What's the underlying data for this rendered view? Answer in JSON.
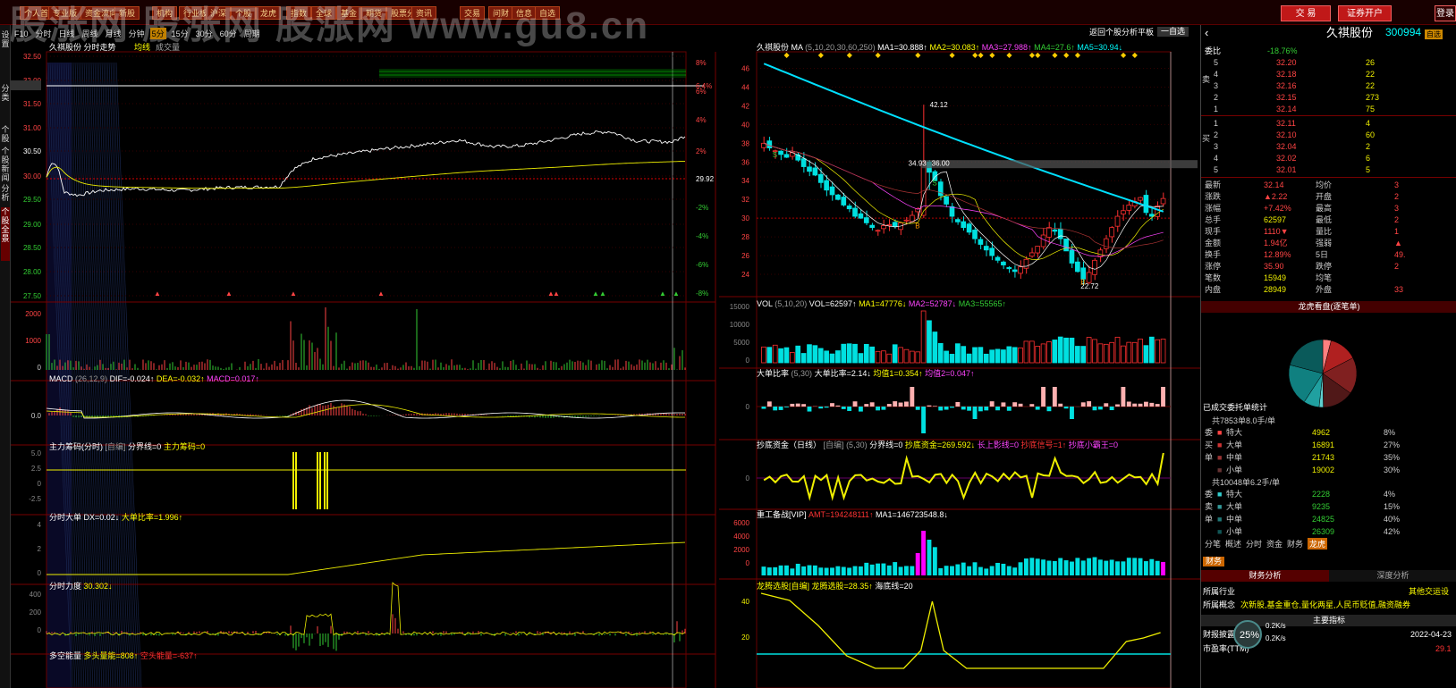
{
  "toolbar": {
    "buttons": [
      "个人首页",
      "专业版",
      "资金流向",
      "新股",
      "机构",
      "行业板块",
      "沪深",
      "个股",
      "龙虎",
      "指数",
      "全球",
      "基金",
      "期货",
      "股票分析",
      "资讯",
      "交易",
      "问财",
      "信息",
      "自选"
    ],
    "trade": "交 易",
    "open_account": "证券开户",
    "login": "登录"
  },
  "watermark": "股涨网 股涨网 股涨网 www.gu8.cn",
  "left_strip": [
    "设置",
    "分类",
    "个股",
    "个股新闻",
    "分析",
    "个股全景"
  ],
  "timeline_tabs": [
    "F10",
    "分时",
    "日线",
    "周线",
    "月线",
    "分钟",
    "5分",
    "15分",
    "30分",
    "60分",
    "周期"
  ],
  "intraday": {
    "title": "久祺股份 分时走势",
    "legend1": "均线",
    "legend2": "成交量",
    "price_left": [
      "32.50",
      "32.00",
      "31.85",
      "31.50",
      "31.00",
      "30.50",
      "30.00",
      "29.50",
      "29.00",
      "28.50",
      "28.00",
      "27.50"
    ],
    "pct_right": [
      "8%",
      "6.4%",
      "6%",
      "4%",
      "2%",
      "29.92",
      "-2%",
      "-4%",
      "-6%",
      "-8%"
    ],
    "vol_ticks": [
      "2000",
      "1000",
      "0"
    ],
    "macd_label": "MACD",
    "macd_params": "(26,12,9)",
    "dif": "DIF=-0.024↑",
    "dea": "DEA=-0.032↑",
    "macd": "MACD=0.017↑",
    "macd_tick": "0.0",
    "zl_label": "主力筹码(分时)",
    "zl_meta": "[自编]",
    "zl_val": "分界线=0",
    "zl_val2": "主力筹码=0",
    "dd_label": "分时大单",
    "dd_val": "DX=0.02↓",
    "dd_val2": "大单比率=1.996↑",
    "ld_label": "分时力度",
    "ld_val": "30.302↓",
    "ld_ticks": [
      "400",
      "200",
      "0"
    ],
    "dk_label": "多空能量",
    "dk_val": "多头量能=808↑",
    "dk_val2": "空头能量=-637↑"
  },
  "kline": {
    "title": "久祺股份",
    "ma_label": "MA",
    "ma_params": "(5,10,20,30,60,250)",
    "ma1": "MA1=30.888↑",
    "ma2": "MA2=30.083↑",
    "ma3": "MA3=27.988↑",
    "ma4": "MA4=27.6↑",
    "ma5": "MA5=30.94↓",
    "header_right": "返回个股分析",
    "header_r2": "平板",
    "header_r3": "一自选",
    "price_ticks": [
      "46",
      "44",
      "42",
      "40",
      "38",
      "36",
      "34",
      "32",
      "30",
      "28",
      "26",
      "24"
    ],
    "hi_label": "42.12",
    "mid_label1": "34.93",
    "mid_label2": "36.00",
    "lo_label": "22.72",
    "vol_label": "VOL",
    "vol_params": "(5,10,20)",
    "vol": "VOL=62597↑",
    "vma1": "MA1=47776↓",
    "vma2": "MA2=52787↓",
    "vma3": "MA3=55565↑",
    "vol_ticks": [
      "15000",
      "10000",
      "5000",
      "0"
    ],
    "dd_label": "大单比率",
    "dd_params": "(5,30)",
    "dd_val": "大单比率=2.14↓",
    "dd_v1": "均值1=0.354↑",
    "dd_v2": "均值2=0.047↑",
    "dd_tick": "0",
    "cd_label": "抄底资金（日线）",
    "cd_meta": "[自编]",
    "cd_params": "(5,30)",
    "cd_v": "分界线=0",
    "cd_v1": "抄底资金=269.592↓",
    "cd_v2": "长上影线=0",
    "cd_v3": "抄底信号=1↑",
    "cd_v4": "抄底小霸王=0",
    "cd_tick": "0",
    "zj_label": "重工备战[VIP]",
    "zj_v1": "AMT=194248111↑",
    "zj_v2": "MA1=146723548.8↓",
    "zj_ticks": [
      "6000",
      "4000",
      "2000",
      "0"
    ],
    "ld_label": "龙腾选股[自编]",
    "ld_v1": "龙腾选股=28.35↑",
    "ld_v2": "海底线=20",
    "ld_ticks": [
      "40",
      "20"
    ]
  },
  "quote": {
    "name": "久祺股份",
    "code": "300994",
    "tag": "自选",
    "webi_label": "委比",
    "webi_val": "-18.76%",
    "sells": [
      [
        "5",
        "32.20",
        "26"
      ],
      [
        "4",
        "32.18",
        "22"
      ],
      [
        "3",
        "32.16",
        "22"
      ],
      [
        "2",
        "32.15",
        "273"
      ],
      [
        "1",
        "32.14",
        "75"
      ]
    ],
    "buys": [
      [
        "1",
        "32.11",
        "4"
      ],
      [
        "2",
        "32.10",
        "60"
      ],
      [
        "3",
        "32.04",
        "2"
      ],
      [
        "4",
        "32.02",
        "6"
      ],
      [
        "5",
        "32.01",
        "5"
      ]
    ],
    "sell_side": "卖",
    "buy_side": "买",
    "pan": "盘",
    "stats": [
      [
        "最新",
        "32.14",
        "均价",
        "3"
      ],
      [
        "涨跌",
        "▲2.22",
        "开盘",
        "2"
      ],
      [
        "涨幅",
        "+7.42%",
        "最高",
        "3"
      ],
      [
        "总手",
        "62597",
        "最低",
        "2"
      ],
      [
        "现手",
        "1110▼",
        "量比",
        "1"
      ],
      [
        "金额",
        "1.94亿",
        "强弱",
        "▲"
      ],
      [
        "换手",
        "12.89%",
        "5日",
        "49."
      ],
      [
        "涨停",
        "35.90",
        "跌停",
        "2"
      ],
      [
        "笔数",
        "15949",
        "均笔",
        ""
      ],
      [
        "内盘",
        "28949",
        "外盘",
        "33"
      ]
    ],
    "pie_title": "龙虎看盘(逐笔单)",
    "deal_title": "已成交委托单统计",
    "buy_total": "共7853单8.0手/单",
    "buy_rows": [
      [
        "特大",
        "4962",
        "8%"
      ],
      [
        "大单",
        "16891",
        "27%"
      ],
      [
        "中单",
        "21743",
        "35%"
      ],
      [
        "小单",
        "19002",
        "30%"
      ]
    ],
    "sell_total": "共10048单6.2手/单",
    "sell_rows": [
      [
        "特大",
        "2228",
        "4%"
      ],
      [
        "大单",
        "9235",
        "15%"
      ],
      [
        "中单",
        "24825",
        "40%"
      ],
      [
        "小单",
        "26309",
        "42%"
      ]
    ],
    "side_buy": [
      "委",
      "买",
      "单"
    ],
    "side_sell": [
      "委",
      "卖",
      "单"
    ],
    "bottom_tabs": [
      "分笔",
      "概述",
      "分时",
      "资金",
      "财务",
      "龙虎"
    ],
    "fin_tab": "财务",
    "fin_left": "财务分析",
    "fin_right": "深度分析",
    "industry_label": "所属行业",
    "industry": "其他交运设",
    "concept_label": "所属概念",
    "concept": "次新股,基金重仓,量化两星,人民币贬值,融资融券",
    "main_ind": "主要指标",
    "report_label": "财报披露",
    "report_date": "2022-04-23",
    "pe_label": "市盈率(TTM)",
    "pe": "29.1",
    "badge_pct": "25%",
    "badge_up": "0.2K/s",
    "badge_down": "0.2K/s"
  },
  "colors": {
    "up": "#ff3030",
    "down": "#00e0e0",
    "ma_long": "#00e0ff",
    "yellow": "#ffff00"
  }
}
